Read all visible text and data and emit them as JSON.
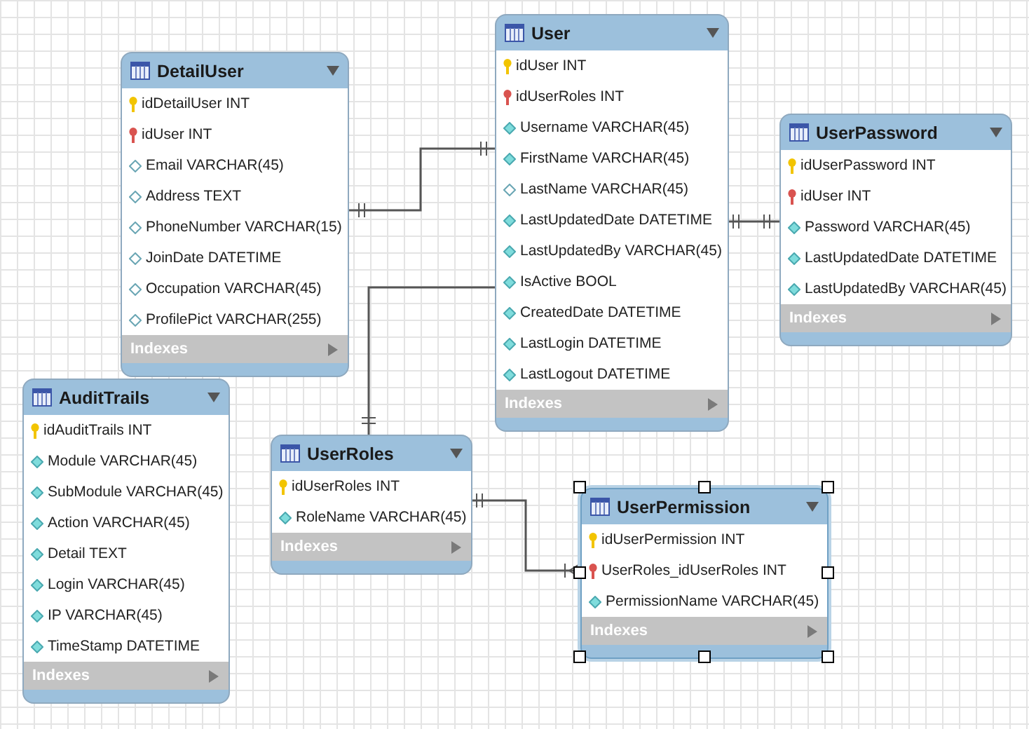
{
  "tables": [
    {
      "name": "DetailUser",
      "selected": false,
      "footer": "Indexes",
      "columns": [
        {
          "label": "idDetailUser INT",
          "kind": "pk"
        },
        {
          "label": "idUser INT",
          "kind": "fk"
        },
        {
          "label": "Email VARCHAR(45)",
          "kind": "nullable"
        },
        {
          "label": "Address TEXT",
          "kind": "nullable"
        },
        {
          "label": "PhoneNumber VARCHAR(15)",
          "kind": "nullable"
        },
        {
          "label": "JoinDate DATETIME",
          "kind": "nullable"
        },
        {
          "label": "Occupation VARCHAR(45)",
          "kind": "nullable"
        },
        {
          "label": "ProfilePict VARCHAR(255)",
          "kind": "nullable"
        }
      ]
    },
    {
      "name": "User",
      "selected": false,
      "footer": "Indexes",
      "columns": [
        {
          "label": "idUser INT",
          "kind": "pk"
        },
        {
          "label": "idUserRoles INT",
          "kind": "fk"
        },
        {
          "label": "Username VARCHAR(45)",
          "kind": "notnull"
        },
        {
          "label": "FirstName VARCHAR(45)",
          "kind": "notnull"
        },
        {
          "label": "LastName VARCHAR(45)",
          "kind": "nullable"
        },
        {
          "label": "LastUpdatedDate DATETIME",
          "kind": "notnull"
        },
        {
          "label": "LastUpdatedBy VARCHAR(45)",
          "kind": "notnull"
        },
        {
          "label": "IsActive BOOL",
          "kind": "notnull"
        },
        {
          "label": "CreatedDate DATETIME",
          "kind": "notnull"
        },
        {
          "label": "LastLogin DATETIME",
          "kind": "notnull"
        },
        {
          "label": "LastLogout DATETIME",
          "kind": "notnull"
        }
      ]
    },
    {
      "name": "UserPassword",
      "selected": false,
      "footer": "Indexes",
      "columns": [
        {
          "label": "idUserPassword INT",
          "kind": "pk"
        },
        {
          "label": "idUser INT",
          "kind": "fk"
        },
        {
          "label": "Password VARCHAR(45)",
          "kind": "notnull"
        },
        {
          "label": "LastUpdatedDate DATETIME",
          "kind": "notnull"
        },
        {
          "label": "LastUpdatedBy VARCHAR(45)",
          "kind": "notnull"
        }
      ]
    },
    {
      "name": "AuditTrails",
      "selected": false,
      "footer": "Indexes",
      "columns": [
        {
          "label": "idAuditTrails INT",
          "kind": "pk"
        },
        {
          "label": "Module VARCHAR(45)",
          "kind": "notnull"
        },
        {
          "label": "SubModule VARCHAR(45)",
          "kind": "notnull"
        },
        {
          "label": "Action VARCHAR(45)",
          "kind": "notnull"
        },
        {
          "label": "Detail TEXT",
          "kind": "notnull"
        },
        {
          "label": "Login VARCHAR(45)",
          "kind": "notnull"
        },
        {
          "label": "IP VARCHAR(45)",
          "kind": "notnull"
        },
        {
          "label": "TimeStamp DATETIME",
          "kind": "notnull"
        }
      ]
    },
    {
      "name": "UserRoles",
      "selected": false,
      "footer": "Indexes",
      "columns": [
        {
          "label": "idUserRoles INT",
          "kind": "pk"
        },
        {
          "label": "RoleName VARCHAR(45)",
          "kind": "notnull"
        }
      ]
    },
    {
      "name": "UserPermission",
      "selected": true,
      "footer": "Indexes",
      "columns": [
        {
          "label": "idUserPermission INT",
          "kind": "pk"
        },
        {
          "label": "UserRoles_idUserRoles INT",
          "kind": "fk"
        },
        {
          "label": "PermissionName VARCHAR(45)",
          "kind": "notnull"
        }
      ]
    }
  ]
}
